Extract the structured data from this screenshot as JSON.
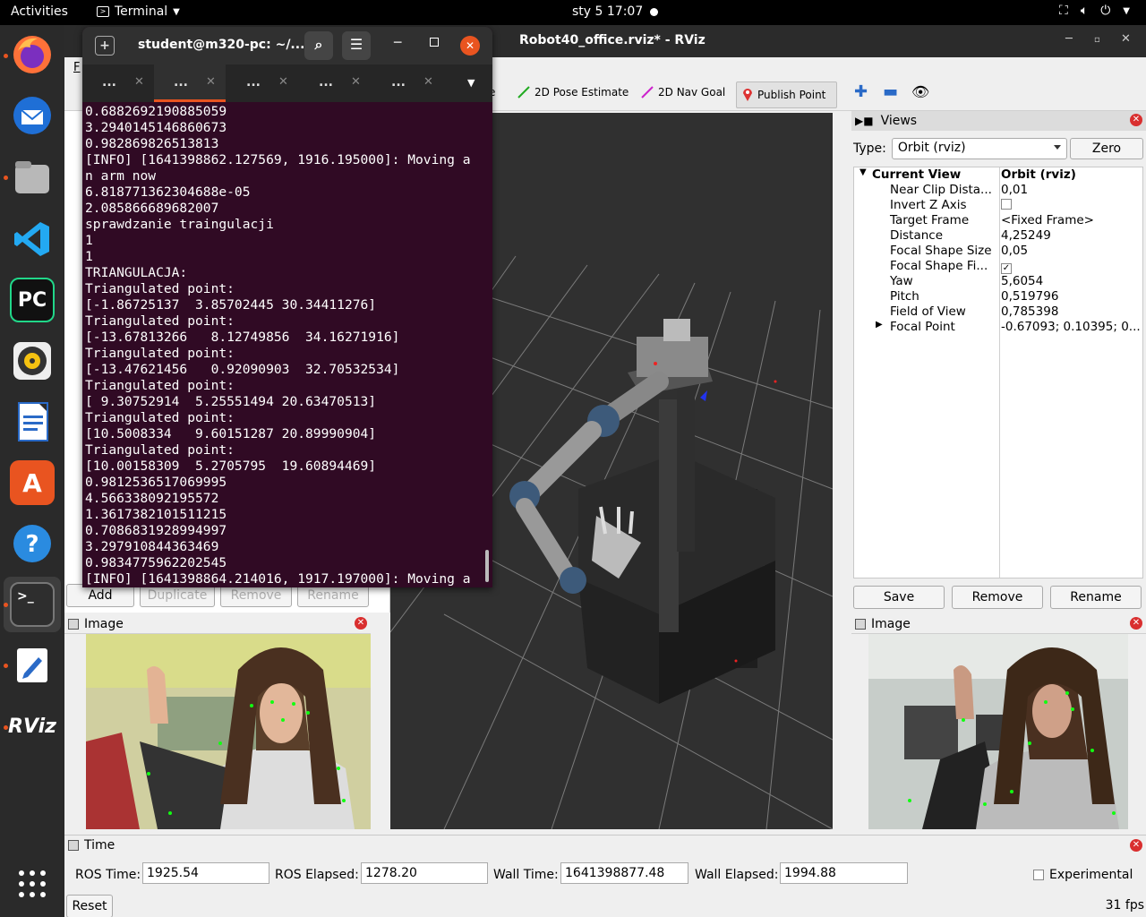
{
  "topbar": {
    "activities": "Activities",
    "app_menu": "Terminal",
    "clock": "sty 5  17:07"
  },
  "dock": {
    "apps": [
      "firefox",
      "thunderbird",
      "files",
      "vscode",
      "pycharm",
      "rhythmbox",
      "libreoffice-writer",
      "app-center",
      "help",
      "terminal",
      "text-editor",
      "rviz"
    ],
    "apps_grid_icon": "apps-grid-icon"
  },
  "rviz": {
    "title": "Robot40_office.rviz* - RViz",
    "menu_partial": "F",
    "toolbar": {
      "pose_estimate": "2D Pose Estimate",
      "nav_goal": "2D Nav Goal",
      "publish_point": "Publish Point",
      "partial_e": "e"
    },
    "displays_buttons": {
      "add": "Add",
      "duplicate": "Duplicate",
      "remove": "Remove",
      "rename": "Rename"
    },
    "left_image": {
      "title": "Image"
    },
    "right_image": {
      "title": "Image"
    },
    "views": {
      "title": "Views",
      "type_label": "Type:",
      "type_value": "Orbit (rviz)",
      "zero": "Zero",
      "header_name": "Current View",
      "header_value": "Orbit (rviz)",
      "props": [
        {
          "name": "Near Clip Dista...",
          "value": "0,01"
        },
        {
          "name": "Invert Z Axis",
          "value": ""
        },
        {
          "name": "Target Frame",
          "value": "<Fixed Frame>"
        },
        {
          "name": "Distance",
          "value": "4,25249"
        },
        {
          "name": "Focal Shape Size",
          "value": "0,05"
        },
        {
          "name": "Focal Shape Fi...",
          "value": "✓"
        },
        {
          "name": "Yaw",
          "value": "5,6054"
        },
        {
          "name": "Pitch",
          "value": "0,519796"
        },
        {
          "name": "Field of View",
          "value": "0,785398"
        },
        {
          "name": "Focal Point",
          "value": "-0.67093; 0.10395; 0...."
        }
      ],
      "save": "Save",
      "remove": "Remove",
      "rename": "Rename"
    },
    "time": {
      "title": "Time",
      "ros_time_label": "ROS Time:",
      "ros_time": "1925.54",
      "ros_elapsed_label": "ROS Elapsed:",
      "ros_elapsed": "1278.20",
      "wall_time_label": "Wall Time:",
      "wall_time": "1641398877.48",
      "wall_elapsed_label": "Wall Elapsed:",
      "wall_elapsed": "1994.88",
      "experimental": "Experimental",
      "reset": "Reset",
      "fps": "31 fps"
    }
  },
  "terminal": {
    "title": "student@m320-pc: ~/...",
    "tabs": [
      "...",
      "...",
      "...",
      "...",
      "..."
    ],
    "lines": [
      "0.6882692190885059",
      "3.2940145146860673",
      "0.982869826513813",
      "[INFO] [1641398862.127569, 1916.195000]: Moving a",
      "n arm now",
      "6.818771362304688e-05",
      "2.085866689682007",
      "sprawdzanie traingulacji",
      "1",
      "1",
      "TRIANGULACJA:",
      "Triangulated point:",
      "[-1.86725137  3.85702445 30.34411276]",
      "Triangulated point:",
      "[-13.67813266   8.12749856  34.16271916]",
      "Triangulated point:",
      "[-13.47621456   0.92090903  32.70532534]",
      "Triangulated point:",
      "[ 9.30752914  5.25551494 20.63470513]",
      "Triangulated point:",
      "[10.5008334   9.60151287 20.89990904]",
      "Triangulated point:",
      "[10.00158309  5.2705795  19.60894469]",
      "0.9812536517069995",
      "4.566338092195572",
      "1.3617382101511215",
      "0.7086831928994997",
      "3.297910844363469",
      "0.9834775962202545",
      "[INFO] [1641398864.214016, 1917.197000]: Moving a"
    ]
  }
}
